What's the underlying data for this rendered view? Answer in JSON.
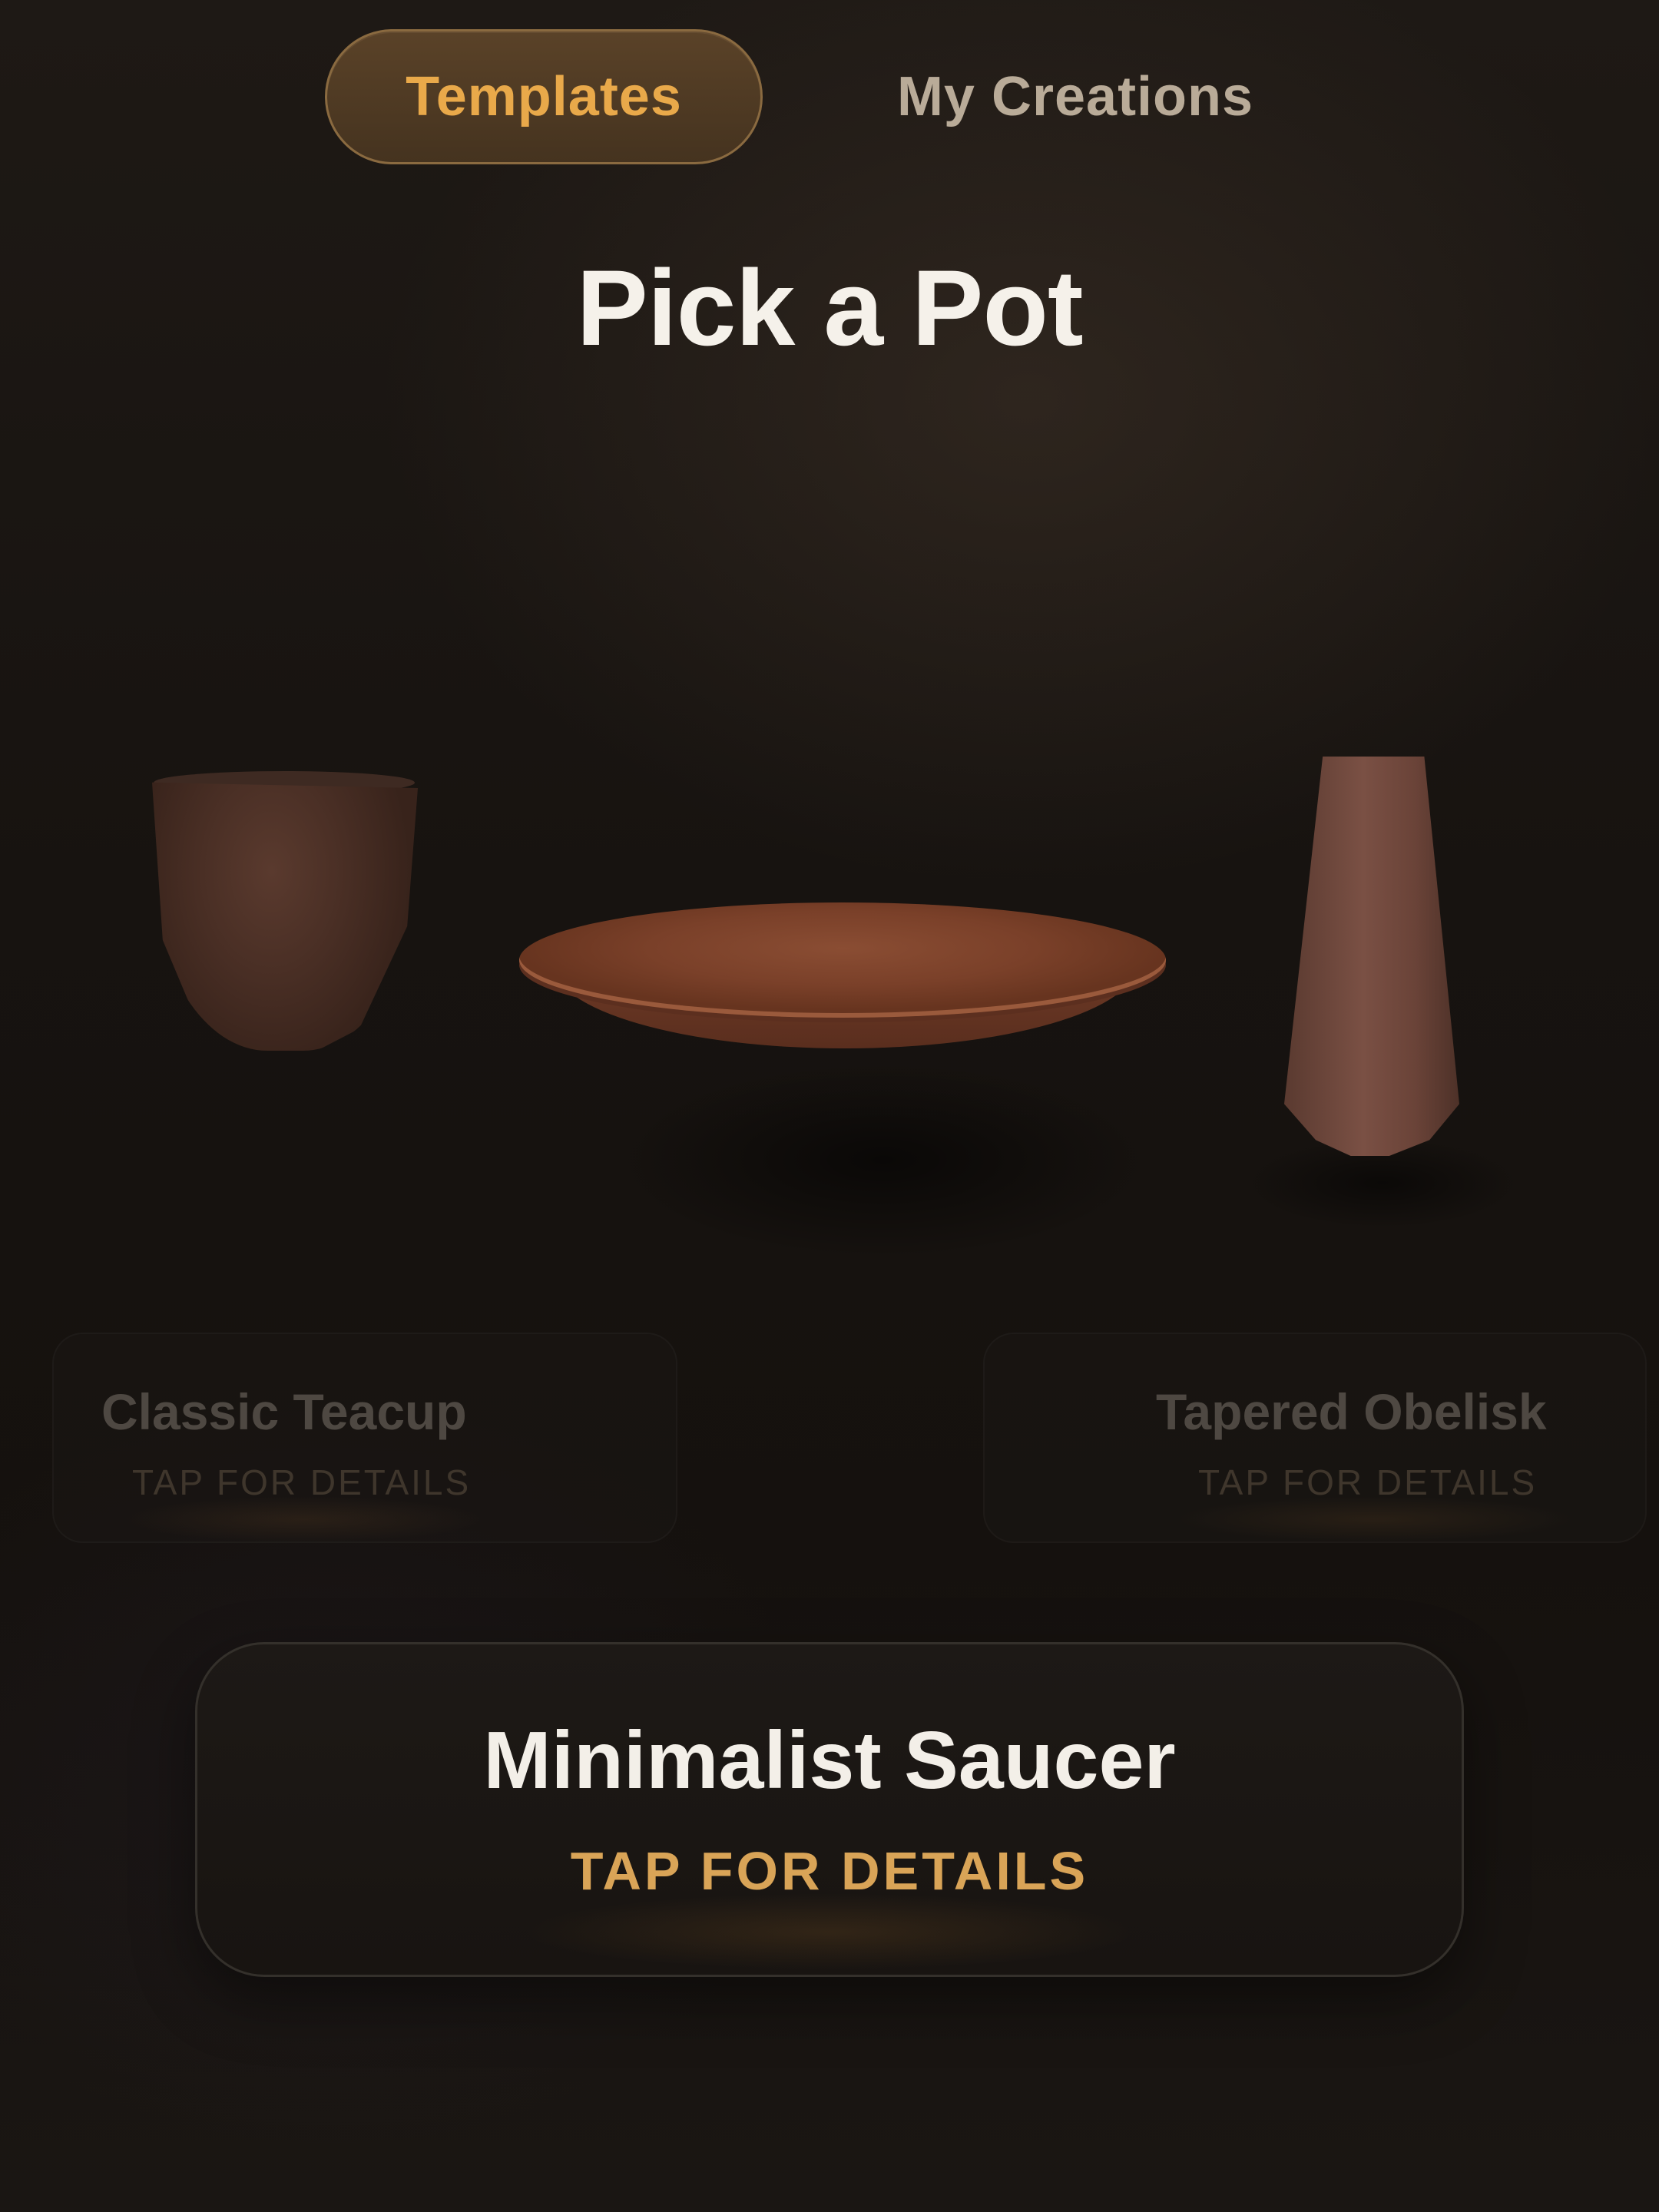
{
  "tabs": {
    "templates": "Templates",
    "my_creations": "My Creations",
    "selected": "Templates"
  },
  "page": {
    "title": "Pick a Pot"
  },
  "carousel": {
    "left": {
      "name": "Classic Teacup",
      "action": "TAP FOR DETAILS"
    },
    "center": {
      "name": "Minimalist Saucer",
      "action": "TAP FOR DETAILS"
    },
    "right": {
      "name": "Tapered Obelisk",
      "action": "TAP FOR DETAILS"
    }
  },
  "colors": {
    "accent": "#e9a94a",
    "background": "#181411",
    "clay": "#7a4029"
  }
}
